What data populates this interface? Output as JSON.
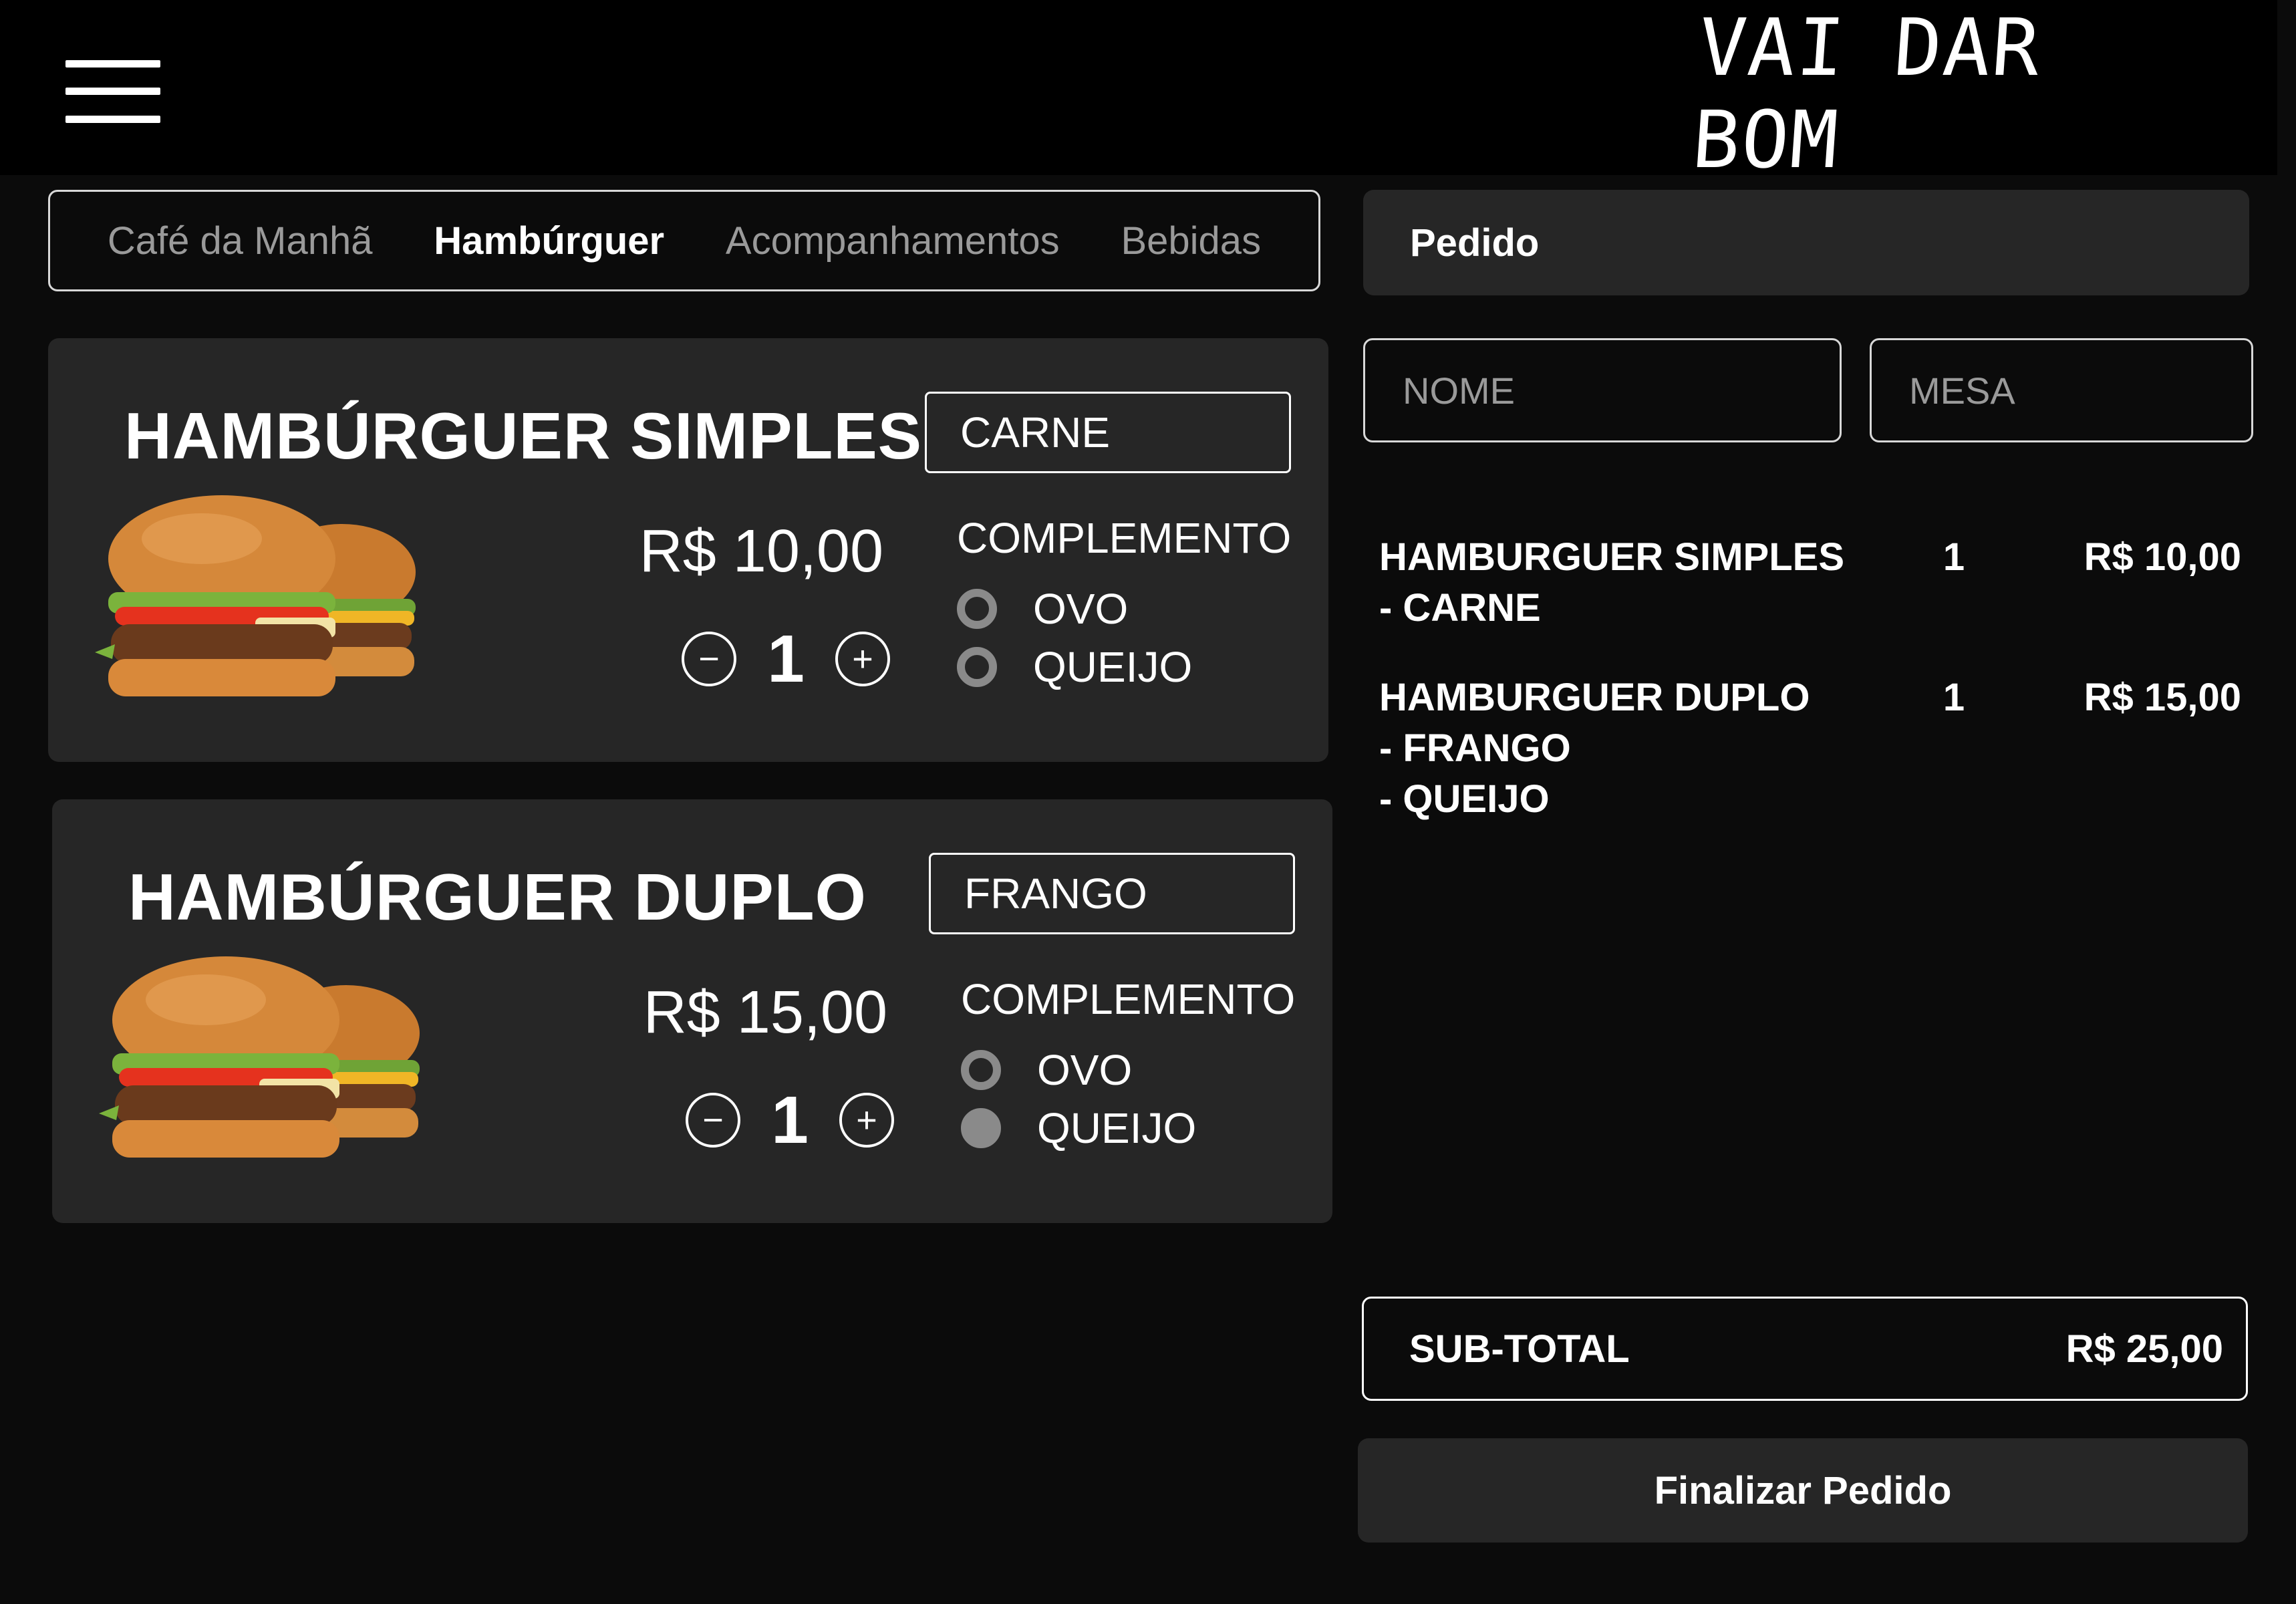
{
  "header": {
    "logo_text": "VAI DAR BOM"
  },
  "tabs": [
    {
      "label": "Café da Manhã",
      "active": false
    },
    {
      "label": "Hambúrguer",
      "active": true
    },
    {
      "label": "Acompanhamentos",
      "active": false
    },
    {
      "label": "Bebidas",
      "active": false
    }
  ],
  "products": [
    {
      "title": "HAMBÚRGUER SIMPLES",
      "price": "R$ 10,00",
      "quantity": "1",
      "protein_selected": "CARNE",
      "complement_label": "COMPLEMENTO",
      "options": [
        {
          "label": "OVO",
          "checked": false
        },
        {
          "label": "QUEIJO",
          "checked": false
        }
      ]
    },
    {
      "title": "HAMBÚRGUER DUPLO",
      "price": "R$ 15,00",
      "quantity": "1",
      "protein_selected": "FRANGO",
      "complement_label": "COMPLEMENTO",
      "options": [
        {
          "label": "OVO",
          "checked": false
        },
        {
          "label": "QUEIJO",
          "checked": true
        }
      ]
    }
  ],
  "order": {
    "title": "Pedido",
    "name_placeholder": "NOME",
    "table_placeholder": "MESA",
    "items": [
      {
        "lines": [
          "HAMBURGUER SIMPLES",
          "- CARNE"
        ],
        "qty": "1",
        "price": "R$ 10,00"
      },
      {
        "lines": [
          "HAMBURGUER DUPLO",
          "- FRANGO",
          "- QUEIJO"
        ],
        "qty": "1",
        "price": "R$ 15,00"
      }
    ],
    "subtotal_label": "SUB-TOTAL",
    "subtotal_value": "R$ 25,00",
    "finalize_label": "Finalizar Pedido"
  },
  "icons": {
    "menu": "hamburger-menu-icon",
    "minus": "minus-circle-icon",
    "plus": "plus-circle-icon",
    "radio": "radio-button-icon"
  },
  "colors": {
    "background": "#0b0b0b",
    "topbar": "#000000",
    "card": "#262626",
    "muted_text": "#9a9a9a",
    "radio": "#8a8a8a"
  }
}
